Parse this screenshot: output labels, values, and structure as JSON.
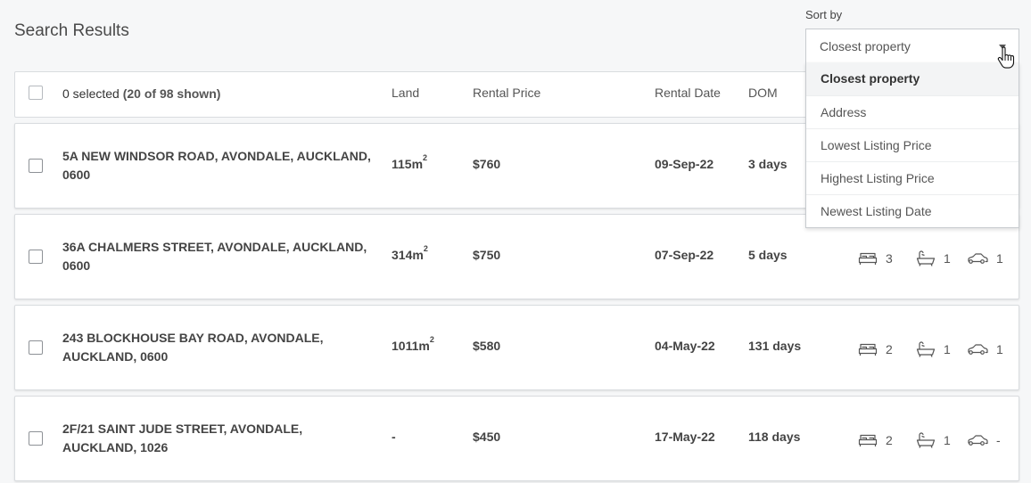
{
  "page_title": "Search Results",
  "header": {
    "selected_count": "0 selected",
    "shown": "(20 of 98 shown)",
    "col_land": "Land",
    "col_price": "Rental Price",
    "col_date": "Rental Date",
    "col_dom": "DOM"
  },
  "sort": {
    "label": "Sort by",
    "selected": "Closest property",
    "options": [
      "Closest property",
      "Address",
      "Lowest Listing Price",
      "Highest Listing Price",
      "Newest Listing Date"
    ]
  },
  "listings": [
    {
      "address": "5A NEW WINDSOR ROAD, AVONDALE, AUCKLAND, 0600",
      "land": "115m",
      "land_sup": "2",
      "price": "$760",
      "date": "09-Sep-22",
      "dom": "3 days",
      "beds": "",
      "baths": "",
      "cars": ""
    },
    {
      "address": "36A CHALMERS STREET, AVONDALE, AUCKLAND, 0600",
      "land": "314m",
      "land_sup": "2",
      "price": "$750",
      "date": "07-Sep-22",
      "dom": "5 days",
      "beds": "3",
      "baths": "1",
      "cars": "1"
    },
    {
      "address": "243 BLOCKHOUSE BAY ROAD, AVONDALE, AUCKLAND, 0600",
      "land": "1011m",
      "land_sup": "2",
      "price": "$580",
      "date": "04-May-22",
      "dom": "131 days",
      "beds": "2",
      "baths": "1",
      "cars": "1"
    },
    {
      "address": "2F/21 SAINT JUDE STREET, AVONDALE, AUCKLAND, 1026",
      "land": "-",
      "land_sup": "",
      "price": "$450",
      "date": "17-May-22",
      "dom": "118 days",
      "beds": "2",
      "baths": "1",
      "cars": "-"
    }
  ],
  "icons": {
    "bed": "bed-icon",
    "bath": "bath-icon",
    "car": "car-icon",
    "cursor": "hand-pointer-icon",
    "caret": "caret-down-icon"
  }
}
